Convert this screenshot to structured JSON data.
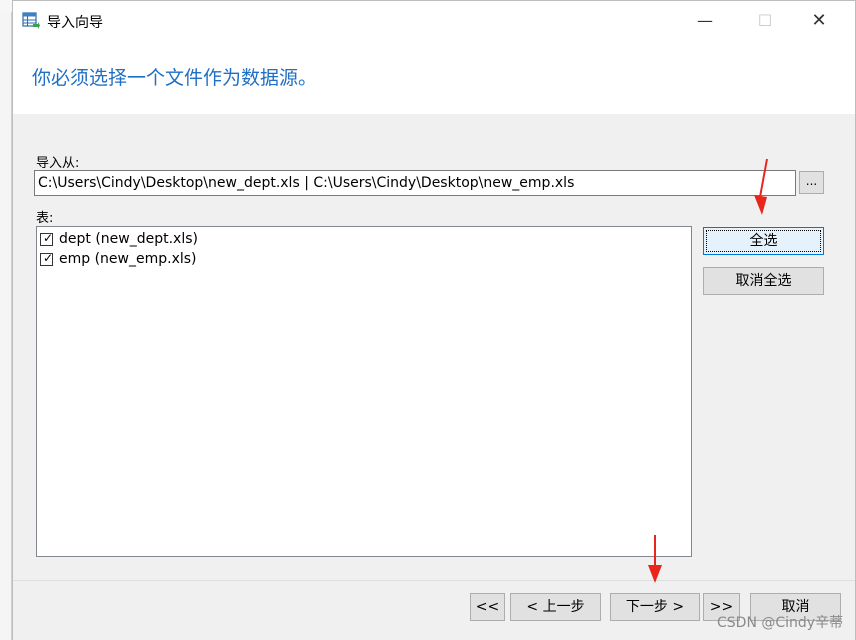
{
  "window": {
    "title": "导入向导",
    "min_symbol": "—",
    "max_symbol": "☐",
    "close_symbol": "✕"
  },
  "heading": "你必须选择一个文件作为数据源。",
  "import_from": {
    "label": "导入从:",
    "value": "C:\\Users\\Cindy\\Desktop\\new_dept.xls | C:\\Users\\Cindy\\Desktop\\new_emp.xls",
    "browse_label": "..."
  },
  "tables": {
    "label": "表:",
    "items": [
      {
        "label": "dept (new_dept.xls)",
        "checked": true
      },
      {
        "label": "emp (new_emp.xls)",
        "checked": true
      }
    ]
  },
  "side_buttons": {
    "select_all": "全选",
    "deselect_all": "取消全选"
  },
  "footer": {
    "first": "<<",
    "prev": "< 上一步",
    "next": "下一步 >",
    "last": ">>",
    "cancel": "取消"
  },
  "watermark": "CSDN @Cindy辛蒂",
  "colors": {
    "heading": "#1f6fc5",
    "arrow": "#e8261c",
    "accent_border": "#0078d7"
  }
}
